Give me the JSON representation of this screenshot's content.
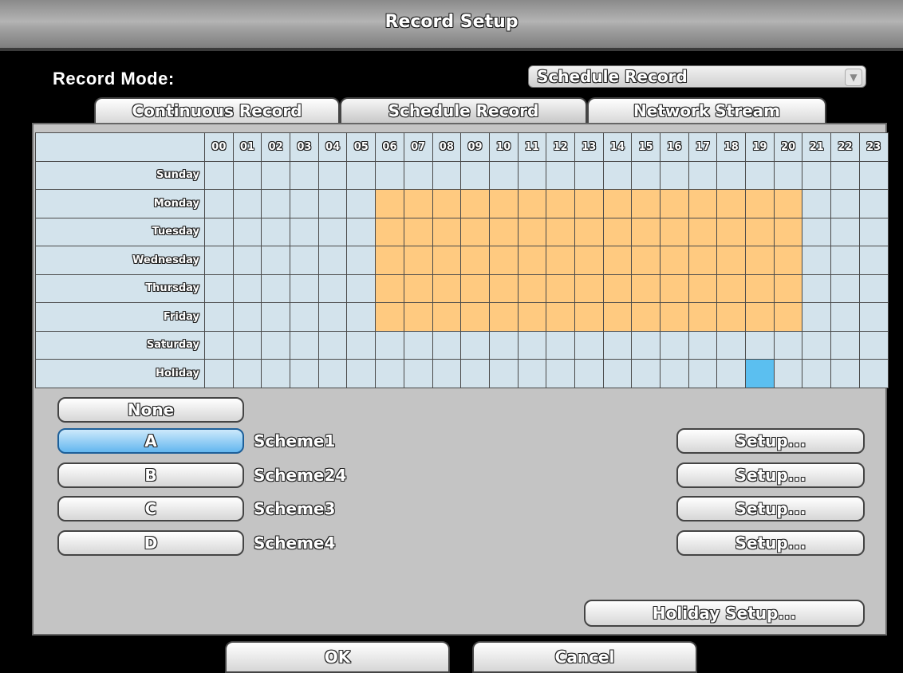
{
  "window": {
    "title": "Record Setup"
  },
  "record_mode": {
    "label": "Record Mode:",
    "value": "Schedule Record"
  },
  "tabs": [
    {
      "label": "Continuous Record"
    },
    {
      "label": "Schedule Record"
    },
    {
      "label": "Network Stream"
    }
  ],
  "hours": [
    "00",
    "01",
    "02",
    "03",
    "04",
    "05",
    "06",
    "07",
    "08",
    "09",
    "10",
    "11",
    "12",
    "13",
    "14",
    "15",
    "16",
    "17",
    "18",
    "19",
    "20",
    "21",
    "22",
    "23"
  ],
  "days": [
    {
      "name": "Sunday",
      "cells": ""
    },
    {
      "name": "Monday",
      "cells": "6-20"
    },
    {
      "name": "Tuesday",
      "cells": "6-20"
    },
    {
      "name": "Wednesday",
      "cells": "6-20"
    },
    {
      "name": "Thursday",
      "cells": "6-20"
    },
    {
      "name": "Friday",
      "cells": "6-20"
    },
    {
      "name": "Saturday",
      "cells": ""
    },
    {
      "name": "Holiday",
      "cells": "19"
    }
  ],
  "schedule_colors": {
    "record": "#ffca80",
    "holiday": "#5bbff0",
    "empty": "#d3e3ec"
  },
  "none_label": "None",
  "schemes": [
    {
      "letter": "A",
      "name": "Scheme1",
      "setup_label": "Setup..."
    },
    {
      "letter": "B",
      "name": "Scheme24",
      "setup_label": "Setup..."
    },
    {
      "letter": "C",
      "name": "Scheme3",
      "setup_label": "Setup..."
    },
    {
      "letter": "D",
      "name": "Scheme4",
      "setup_label": "Setup..."
    }
  ],
  "holiday_setup_label": "Holiday Setup...",
  "footer": {
    "ok_label": "OK",
    "cancel_label": "Cancel"
  }
}
